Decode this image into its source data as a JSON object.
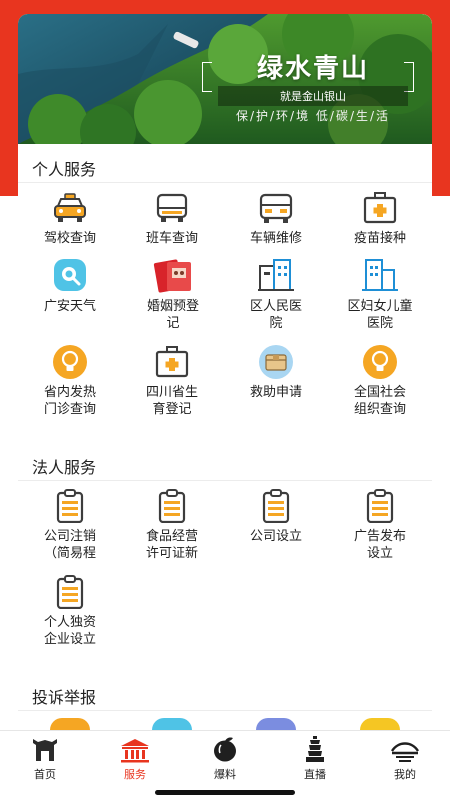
{
  "banner": {
    "title": "绿水青山",
    "subtitle": "就是金山银山",
    "slogan": "保/护/环/境 低/碳/生/活"
  },
  "personal": {
    "title": "个人服务",
    "items": [
      {
        "label": "驾校查询",
        "icon": "taxi-icon"
      },
      {
        "label": "班车查询",
        "icon": "bus-icon"
      },
      {
        "label": "车辆维修",
        "icon": "bus-repair-icon"
      },
      {
        "label": "疫苗接种",
        "icon": "medical-kit-icon"
      },
      {
        "label": "广安天气",
        "icon": "weather-search-icon"
      },
      {
        "label": "婚姻预登记",
        "icon": "marriage-icon"
      },
      {
        "label": "区人民医院",
        "icon": "hospital-building-icon"
      },
      {
        "label": "区妇女儿童医院",
        "icon": "hospital-building-icon"
      },
      {
        "label": "省内发热门诊查询",
        "icon": "lightbulb-icon"
      },
      {
        "label": "四川省生育登记",
        "icon": "medical-kit-icon"
      },
      {
        "label": "救助申请",
        "icon": "package-icon"
      },
      {
        "label": "全国社会组织查询",
        "icon": "lightbulb-icon"
      }
    ]
  },
  "legal": {
    "title": "法人服务",
    "items": [
      {
        "label": "公司注销（简易程",
        "icon": "clipboard-icon"
      },
      {
        "label": "食品经营许可证新",
        "icon": "clipboard-icon"
      },
      {
        "label": "公司设立",
        "icon": "clipboard-icon"
      },
      {
        "label": "广告发布设立",
        "icon": "clipboard-icon"
      },
      {
        "label": "个人独资企业设立",
        "icon": "clipboard-icon"
      }
    ]
  },
  "complaint": {
    "title": "投诉举报"
  },
  "tabs": [
    {
      "label": "首页",
      "icon": "home-gate-icon",
      "active": false
    },
    {
      "label": "服务",
      "icon": "service-building-icon",
      "active": true
    },
    {
      "label": "爆料",
      "icon": "fruit-icon",
      "active": false
    },
    {
      "label": "直播",
      "icon": "tower-icon",
      "active": false
    },
    {
      "label": "我的",
      "icon": "bridge-icon",
      "active": false
    }
  ],
  "colors": {
    "accent": "#e8351f",
    "icon_dark": "#3d3d3d",
    "icon_orange": "#f5a623",
    "icon_blue": "#1e8fd6"
  }
}
